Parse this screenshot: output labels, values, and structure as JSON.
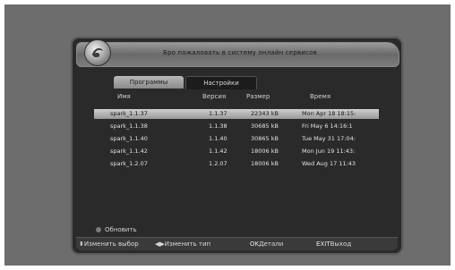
{
  "header": {
    "title": "Бро пожаловать в систему онлайн сервисов"
  },
  "tabs": [
    {
      "label": "Программы",
      "active": true
    },
    {
      "label": "Настройки",
      "active": false
    }
  ],
  "columns": {
    "name": "Имя",
    "version": "Версия",
    "size": "Размер",
    "time": "Время"
  },
  "rows": [
    {
      "name": "spark_1.1.37",
      "version": "1.1.37",
      "size": "22343 kB",
      "time": "Mon Apr 18 18:15:",
      "selected": true
    },
    {
      "name": "spark_1.1.38",
      "version": "1.1.38",
      "size": "30685 kB",
      "time": "Fri May  6 14:16:1"
    },
    {
      "name": "spark_1.1.40",
      "version": "1.1.40",
      "size": "30865 kB",
      "time": "Tue May 31 17:04:"
    },
    {
      "name": "spark_1.1.42",
      "version": "1.1.42",
      "size": "18006 kB",
      "time": "Mon Jun 19 11:43:"
    },
    {
      "name": "spark_1.2.07",
      "version": "1.2.07",
      "size": "18006 kB",
      "time": "Wed Aug 17 11:43"
    }
  ],
  "refresh_label": "Обновить",
  "footer": {
    "select_label": "Изменить выбор",
    "type_label": "Изменить тип",
    "ok_key": "OK",
    "ok_label": "Детали",
    "exit_key": "EXIT",
    "exit_label": "Выход"
  },
  "colors": {
    "selected_row": "#b5b5b5",
    "panel": "#2a2a2a",
    "background": "#6d6d6d"
  }
}
